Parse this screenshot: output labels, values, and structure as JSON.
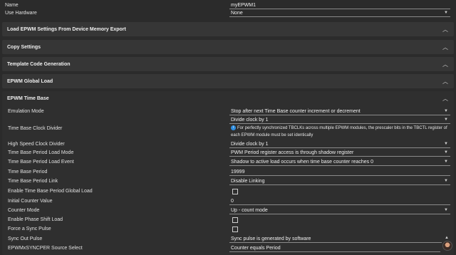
{
  "top": {
    "name": {
      "label": "Name",
      "value": "myEPWM1"
    },
    "use_hardware": {
      "label": "Use Hardware",
      "value": "None"
    }
  },
  "sections": {
    "load_settings": "Load EPWM Settings From Device Memory Export",
    "copy_settings": "Copy Settings",
    "template": "Template Code Generation",
    "global_load": "EPWM Global Load",
    "time_base": "EPWM Time Base"
  },
  "time_base": {
    "emulation_mode": {
      "label": "Emulation Mode",
      "value": "Stop after next Time Base counter increment or decrement"
    },
    "clock_divider": {
      "label": "Time Base Clock Divider",
      "value": "Divide clock by 1",
      "info": "For perfectly synchronized TBCLKs across multiple EPWM modules, the prescaler bits in the TBCTL register of each EPWM module must be set identically"
    },
    "hs_clock_divider": {
      "label": "High Speed Clock Divider",
      "value": "Divide clock by 1"
    },
    "period_load_mode": {
      "label": "Time Base Period Load Mode",
      "value": "PWM Period register access is through shadow register"
    },
    "period_load_event": {
      "label": "Time Base Period Load Event",
      "value": "Shadow to active load occurs when time base counter reaches 0"
    },
    "period": {
      "label": "Time Base Period",
      "value": "19999"
    },
    "period_link": {
      "label": "Time Base Period Link",
      "value": "Disable Linking"
    },
    "global_load_enable": {
      "label": "Enable Time Base Period Global Load",
      "checked": false
    },
    "initial_counter": {
      "label": "Initial Counter Value",
      "value": "0"
    },
    "counter_mode": {
      "label": "Counter Mode",
      "value": "Up - count mode"
    },
    "phase_shift_load": {
      "label": "Enable Phase Shift Load",
      "checked": false
    },
    "force_sync": {
      "label": "Force a Sync Pulse",
      "checked": false
    },
    "sync_out": {
      "label": "Sync Out Pulse",
      "value": "Sync pulse is generated by software"
    },
    "syncper_source": {
      "label": "EPWMxSYNCPER Source Select",
      "value": "Counter equals Period"
    }
  },
  "icons": {
    "section_toggle": "chevron-up-icon",
    "select_arrow": "caret-down-icon",
    "info": "info-icon"
  },
  "colors": {
    "background": "#2b2b2b",
    "section": "#363636",
    "info_icon": "#2f8ee0"
  }
}
